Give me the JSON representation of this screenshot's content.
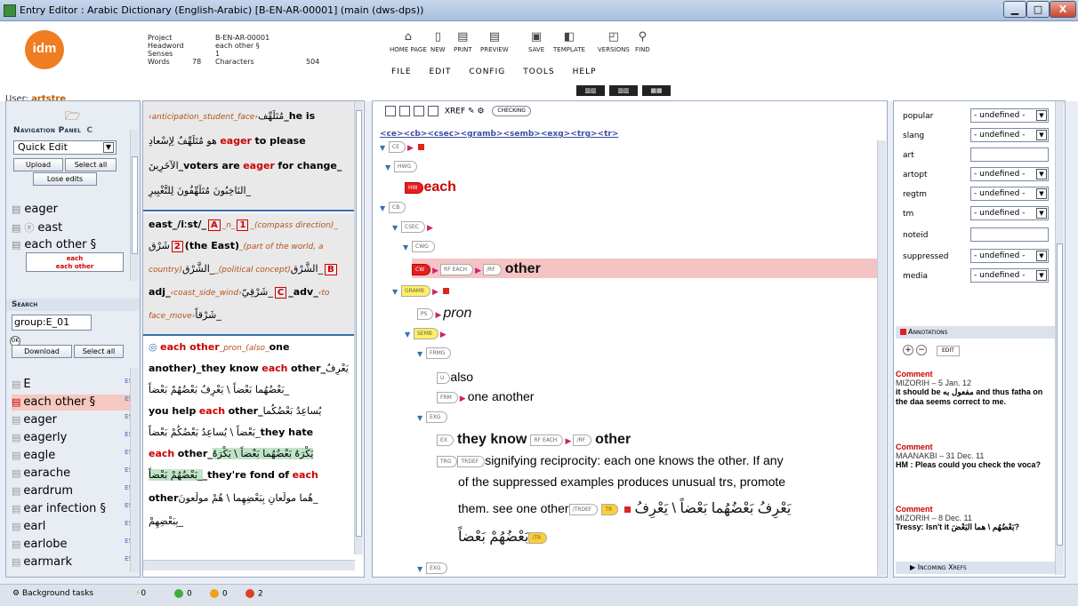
{
  "window": {
    "title": "Entry Editor : Arabic Dictionary (English-Arabic) [B-EN-AR-00001] (main (dws-dps))",
    "minimize": "▁",
    "maximize": "□",
    "close": "X"
  },
  "header": {
    "logo_text": "idm",
    "user_label": "User:",
    "user_name": "artstre",
    "meta": {
      "project_label": "Project",
      "project_value": "B-EN-AR-00001",
      "headword_label": "Headword",
      "headword_value": "each other §",
      "senses_label": "Senses",
      "senses_value": "1",
      "words_label": "Words",
      "words_value": "78",
      "characters_label": "Characters",
      "characters_value": "504"
    },
    "toolbar": [
      "HOME PAGE",
      "NEW",
      "PRINT",
      "PREVIEW",
      "SAVE",
      "TEMPLATE",
      "VERSIONS",
      "FIND"
    ],
    "menu": [
      "FILE",
      "EDIT",
      "CONFIG",
      "TOOLS",
      "HELP"
    ]
  },
  "nav": {
    "title": "Navigation Panel",
    "mode": "Quick Edit",
    "upload": "Upload",
    "select_all": "Select all",
    "lose_edits": "Lose edits",
    "entries": [
      "eager",
      "east",
      "each other §"
    ],
    "sub_entries": [
      "each",
      "each other"
    ],
    "search_title": "Search",
    "search_value": "group:E_01",
    "ok": "OK",
    "download": "Download",
    "select_all_2": "Select all",
    "list": [
      {
        "label": "E",
        "tag": "ES"
      },
      {
        "label": "each other §",
        "tag": "ES"
      },
      {
        "label": "eager",
        "tag": "ES"
      },
      {
        "label": "eagerly",
        "tag": "ES"
      },
      {
        "label": "eagle",
        "tag": "ES"
      },
      {
        "label": "earache",
        "tag": "ES"
      },
      {
        "label": "eardrum",
        "tag": "ES"
      },
      {
        "label": "ear infection §",
        "tag": "ES"
      },
      {
        "label": "earl",
        "tag": "ES"
      },
      {
        "label": "earlobe",
        "tag": "ES"
      },
      {
        "label": "earmark",
        "tag": "ES"
      }
    ]
  },
  "preview": {
    "b1_l1_a": "‹anticipation_student_face›",
    "b1_l1_ar": "مُتَلَهِّف",
    "b1_l1_b": "_he is",
    "b1_l2_ar": "هو مُتَلَهِّفٌ لِإسْعادِ",
    "b1_l2_eager": "eager",
    "b1_l2_b": "to please",
    "b1_l3_ar": "الآخَرِينَ",
    "b1_l3_a": "_voters are",
    "b1_l3_eager": "eager",
    "b1_l3_b": "for change_",
    "b1_l4_ar": "_النَاخِبُونَ مُتَلَهِّفُونَ لِلتَّغْيِيرِ",
    "b2_l1": "east_/iːst/_",
    "b2_A": "A",
    "b2_n": "_n_",
    "b2_1": "1",
    "b2_l1_i": "_(compass direction)_",
    "b2_l2_ar": "شَرْق",
    "b2_2": "2",
    "b2_l2_b": "(the East)",
    "b2_l2_i": "_(part of the world, a",
    "b2_l3_i": "country)",
    "b2_l3_ar": "_الشَّرْق",
    "b2_l3_i2": "_(political concept)",
    "b2_l3_ar2": "_الشَّرْق",
    "b2_B": "B",
    "b2_l4_a": "adj_",
    "b2_l4_i": "‹coast_side_wind›",
    "b2_l4_ar": "_شَرْقِيّ",
    "b2_C": "C",
    "b2_l4_b": "_adv_",
    "b2_l4_i2": "‹to",
    "b2_l5_i": "face_move›",
    "b2_l5_ar": "_شَرْقاً",
    "b3_l1_a": "each other",
    "b3_l1_b": "_pron_(also_",
    "b3_l1_c": "one",
    "b3_l2_a": "another)_they know",
    "b3_l2_each": "each",
    "b3_l2_b": "other_",
    "b3_l2_ar": "يَعْرِفُ",
    "b3_l3_ar": "_بَعْضُهُما بَعْضاً \\ يَعْرِفُ بَعْضُهُمْ بَعْضاً",
    "b3_l4_a": "you help",
    "b3_l4_each": "each",
    "b3_l4_b": "other_",
    "b3_l4_ar": "يُساعِدُ بَعْضُكُما",
    "b3_l5_ar": "_بَعْضاً \\ يُساعِدُ بَعْضُكُمْ بَعْضاً",
    "b3_l5_b": "they hate",
    "b3_l6_each": "each",
    "b3_l6_a": "other_",
    "b3_l6_ar": "يَكْرَهُ بَعْضُهُما بَعْضاً \\ يَكْرَهُ",
    "b3_l7_ar": "_بَعْضُهُمْ بَعْضاً",
    "b3_l7_a": "_they're fond of",
    "b3_l7_each": "each",
    "b3_l8_a": "other",
    "b3_l8_ar": "_هُما مولَعانِ بِبَعْضِهِما \\ هُمْ مولَعونَ",
    "b3_l9_ar": "_بِبَعْضِهِمْ"
  },
  "editor": {
    "toolbar_xref": "XREF",
    "toolbar_checking": "CHECKING",
    "path": [
      "<ce>",
      "<cb>",
      "<csec>",
      "<gramb>",
      "<semb>",
      "<exg>",
      "<trg>",
      "<tr>"
    ],
    "nodes": {
      "ce": "CE",
      "hwg": "HWG",
      "hw": "HW",
      "hw_text": "each",
      "cb": "CB",
      "csec": "CSEC",
      "cwg": "CWG",
      "cw": "CW",
      "rf_each": "RF EACH",
      "rf_close": "/RF",
      "cw_text": "other",
      "gramb": "GRAMB",
      "ps": "PS",
      "ps_text": "pron",
      "semb": "SEMB",
      "frmg": "FRMG",
      "u": "U",
      "u_text": "also",
      "frm": "FRM",
      "frm_text": "one another",
      "exg": "EXG",
      "ex": "EX",
      "ex_text_a": "they know",
      "ex_text_b": "other",
      "trg": "TRG",
      "trdef": "TRDEF",
      "trdef_text_1": "signifying reciprocity: each one knows the other. If any",
      "trdef_text_2": "of the suppressed examples produces unusual trs, promote",
      "trdef_text_3": "them. see one other",
      "trdef_close": "/TRDEF",
      "tr": "TR",
      "tr_close": "/TR",
      "tr_text_1": "يَعْرِفُ بَعْضُهُما بَعْضاً \\ يَعْرِفُ",
      "tr_text_2": "بَعْضُهُمْ بَعْضاً",
      "exg2": "EXG"
    }
  },
  "props": {
    "rows": [
      {
        "label": "popular",
        "value": "- undefined -",
        "select": true
      },
      {
        "label": "slang",
        "value": "- undefined -",
        "select": true
      },
      {
        "label": "art",
        "value": "",
        "select": false
      },
      {
        "label": "artopt",
        "value": "- undefined -",
        "select": true
      },
      {
        "label": "regtm",
        "value": "- undefined -",
        "select": true
      },
      {
        "label": "tm",
        "value": "- undefined -",
        "select": true
      },
      {
        "label": "noteid",
        "value": "",
        "select": false
      },
      {
        "label": "suppressed",
        "value": "- undefined -",
        "select": true
      },
      {
        "label": "media",
        "value": "- undefined -",
        "select": true
      }
    ],
    "annotations_title": "Annotations",
    "edit": "EDIT",
    "comments": [
      {
        "type": "Comment",
        "meta": "MIZORIH  –  5 Jan. 12",
        "body": "it should be مفعول به and thus fatha on the daa seems correct to me."
      },
      {
        "type": "Comment",
        "meta": "MAANAKBI  –  31 Dec. 11",
        "body": "HM : Pleas could you check the voca?"
      },
      {
        "type": "Comment",
        "meta": "MIZORIH  –  8 Dec. 11",
        "body": "Tressy: Isn't it بَعْضُهُم \\ هما البَعْضَ?"
      }
    ],
    "incoming_xrefs": "Incoming Xrefs"
  },
  "status": {
    "background_tasks": "Background tasks",
    "counts": [
      "0",
      "0",
      "0",
      "2"
    ]
  }
}
